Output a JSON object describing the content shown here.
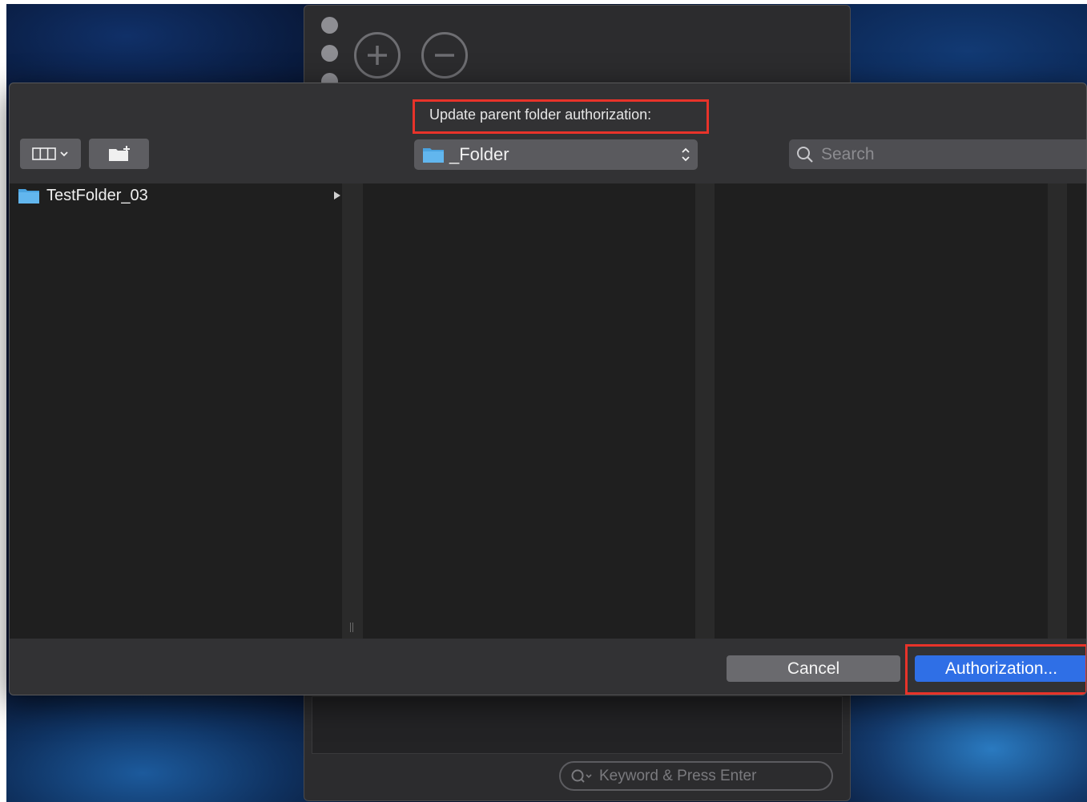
{
  "background_window": {
    "add_icon": "plus-circle-icon",
    "remove_icon": "minus-circle-icon",
    "search_placeholder": "Keyword & Press Enter"
  },
  "dialog": {
    "message": "Update parent folder authorization:",
    "view_button_icon": "column-view-icon",
    "new_folder_icon": "new-folder-icon",
    "path_popup": {
      "selected": "_Folder",
      "icon": "folder-icon"
    },
    "search": {
      "placeholder": "Search",
      "icon": "search-icon"
    },
    "columns": [
      {
        "items": [
          {
            "name": "TestFolder_03",
            "icon": "folder-icon",
            "has_children": true
          }
        ]
      },
      {
        "items": []
      },
      {
        "items": []
      }
    ],
    "buttons": {
      "cancel": "Cancel",
      "authorize": "Authorization..."
    }
  },
  "colors": {
    "accent_blue": "#2f6fe6",
    "highlight_red": "#e8332a",
    "folder_blue": "#4aa3e0"
  }
}
